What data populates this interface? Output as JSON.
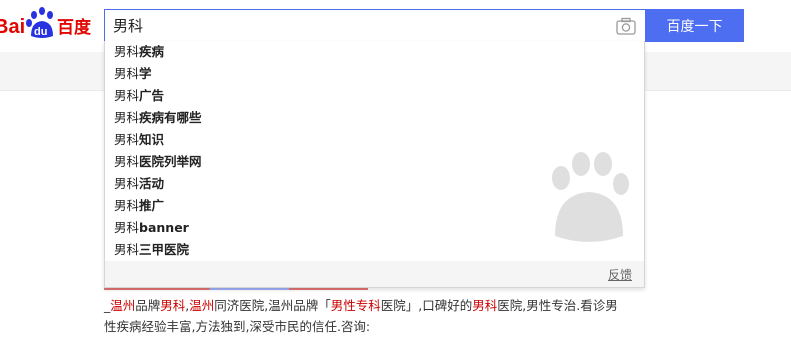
{
  "logo": {
    "text_bai": "Bai",
    "text_du": "du",
    "text_cn": "百度"
  },
  "search": {
    "value": "男科",
    "button_label": "百度一下"
  },
  "suggestions": [
    {
      "prefix": "男科",
      "suffix": "疾病"
    },
    {
      "prefix": "男科",
      "suffix": "学"
    },
    {
      "prefix": "男科",
      "suffix": "广告"
    },
    {
      "prefix": "男科",
      "suffix": "疾病有哪些"
    },
    {
      "prefix": "男科",
      "suffix": "知识"
    },
    {
      "prefix": "男科",
      "suffix": "医院列举网"
    },
    {
      "prefix": "男科",
      "suffix": "活动"
    },
    {
      "prefix": "男科",
      "suffix": "推广"
    },
    {
      "prefix": "男科",
      "suffix": "banner"
    },
    {
      "prefix": "男科",
      "suffix": "三甲医院"
    }
  ],
  "dropdown": {
    "feedback_label": "反馈"
  },
  "result": {
    "line1_parts": [
      "_",
      "温州",
      "品牌",
      "男科",
      ",",
      "温州",
      "同济医院,温州品牌「",
      "男性专科",
      "医院」,口碑好的",
      "男科",
      "医院,男性专治.看诊男"
    ],
    "line2": "性疾病经验丰富,方法独到,深受市民的信任.咨询:"
  },
  "colors": {
    "accent": "#4e6ef2",
    "highlight": "#c00000",
    "logo_red": "#e10601",
    "logo_blue": "#2932e1"
  },
  "icons": {
    "camera": "camera-icon",
    "logo": "baidu-paw-icon"
  }
}
